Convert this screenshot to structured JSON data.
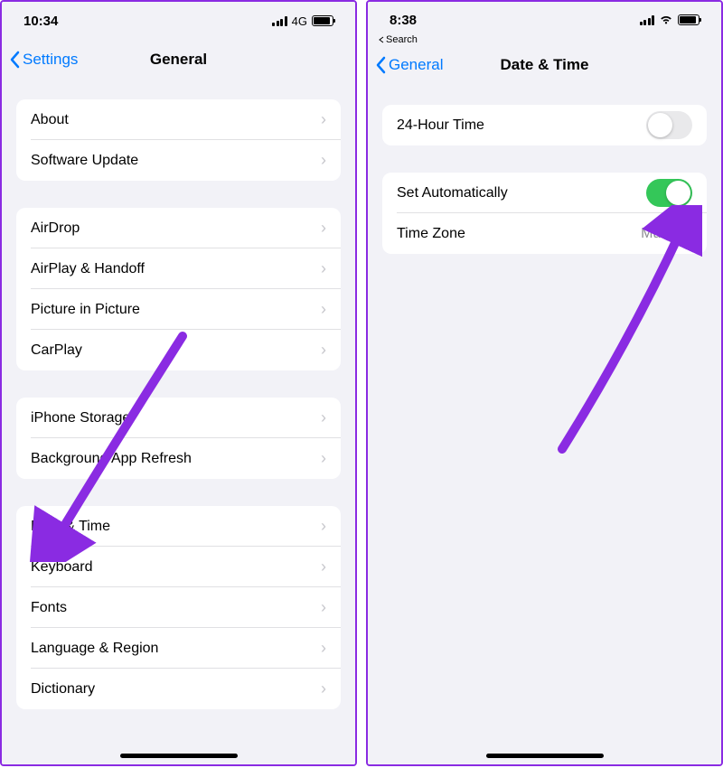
{
  "left": {
    "status": {
      "time": "10:34",
      "network": "4G"
    },
    "nav": {
      "back": "Settings",
      "title": "General"
    },
    "groups": [
      {
        "items": [
          "About",
          "Software Update"
        ]
      },
      {
        "items": [
          "AirDrop",
          "AirPlay & Handoff",
          "Picture in Picture",
          "CarPlay"
        ]
      },
      {
        "items": [
          "iPhone Storage",
          "Background App Refresh"
        ]
      },
      {
        "items": [
          "Date & Time",
          "Keyboard",
          "Fonts",
          "Language & Region",
          "Dictionary"
        ]
      }
    ]
  },
  "right": {
    "status": {
      "time": "8:38"
    },
    "breadcrumb": "Search",
    "nav": {
      "back": "General",
      "title": "Date & Time"
    },
    "rows": {
      "twentyfour": {
        "label": "24-Hour Time",
        "on": false
      },
      "auto": {
        "label": "Set Automatically",
        "on": true
      },
      "tz": {
        "label": "Time Zone",
        "value": "Mumbai"
      }
    }
  },
  "colors": {
    "accent": "#007aff",
    "arrow": "#8a2be2",
    "toggle_on": "#34c759"
  }
}
